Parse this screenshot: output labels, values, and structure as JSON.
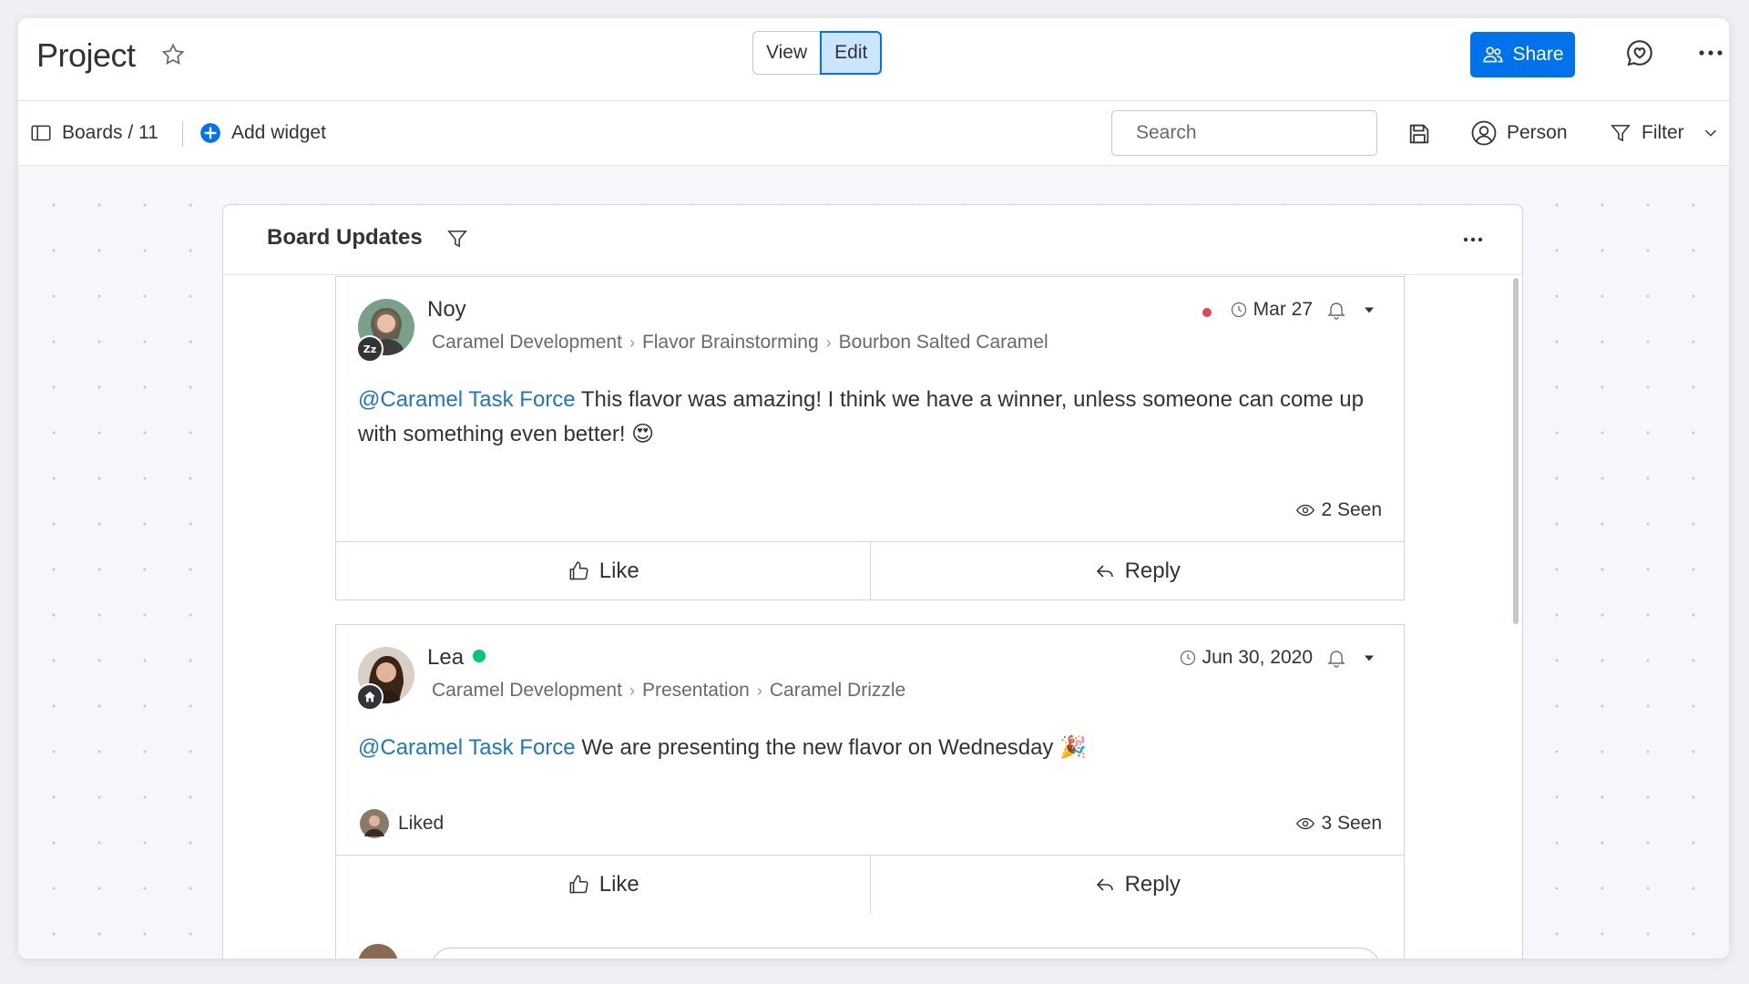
{
  "header": {
    "title": "Project",
    "view_label": "View",
    "edit_label": "Edit",
    "share_label": "Share"
  },
  "toolbar": {
    "boards_label": "Boards / 11",
    "add_widget_label": "Add widget",
    "search_placeholder": "Search",
    "person_label": "Person",
    "filter_label": "Filter"
  },
  "widget": {
    "title": "Board Updates"
  },
  "updates": [
    {
      "author": "Noy",
      "breadcrumbs": [
        "Caramel Development",
        "Flavor Brainstorming",
        "Bourbon Salted Caramel"
      ],
      "date": "Mar 27",
      "mention": "@Caramel Task Force",
      "text": " This flavor was amazing! I think we have a winner, unless someone can come up with something even better! 😍",
      "seen": "2 Seen",
      "like_label": "Like",
      "reply_label": "Reply"
    },
    {
      "author": "Lea",
      "breadcrumbs": [
        "Caramel Development",
        "Presentation",
        "Caramel Drizzle"
      ],
      "date": "Jun 30, 2020",
      "mention": "@Caramel Task Force",
      "text": " We are presenting the new flavor on Wednesday 🎉",
      "liked_label": "Liked",
      "seen": "3 Seen",
      "like_label": "Like",
      "reply_label": "Reply"
    }
  ],
  "colors": {
    "accent": "#0073ea",
    "mention": "#1f76c2",
    "online": "#00c875",
    "unread": "#e2445c"
  }
}
